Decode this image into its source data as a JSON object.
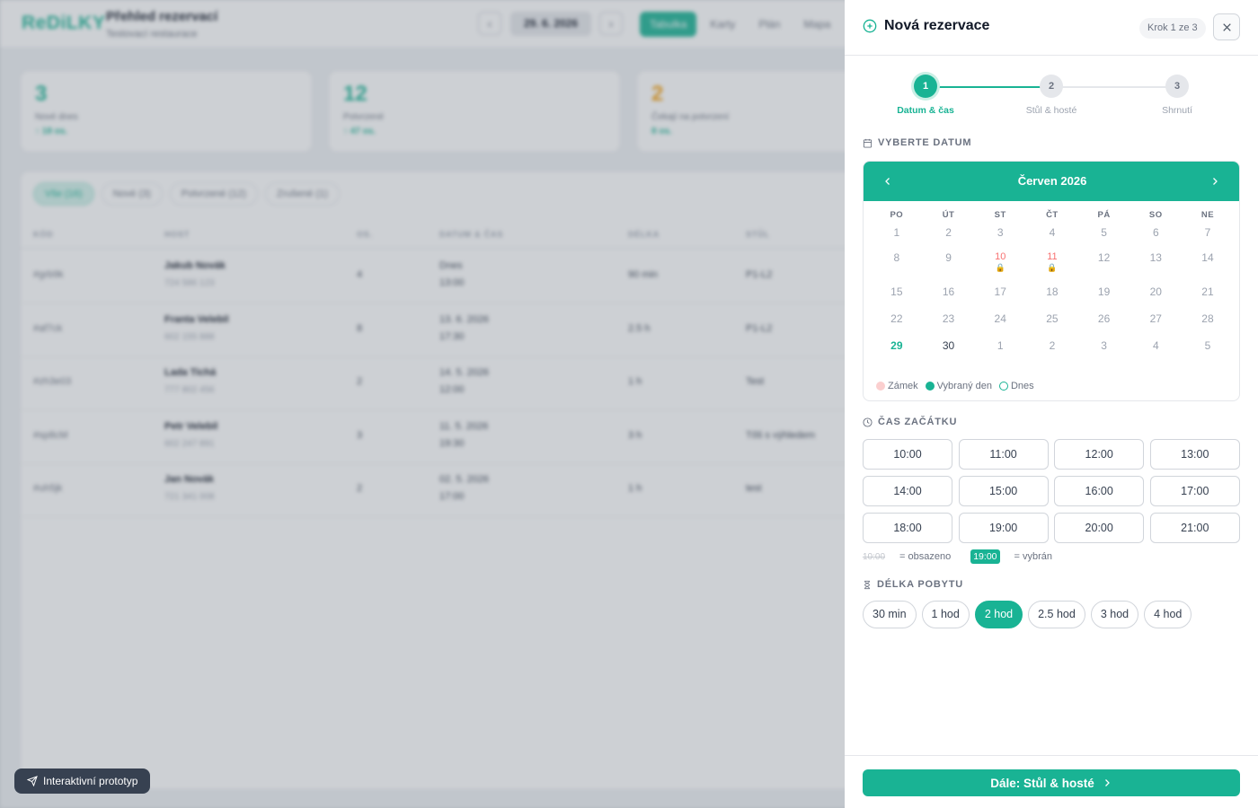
{
  "background": {
    "logo": "ReDiLKY",
    "title": "Přehled rezervací",
    "subtitle": "Testovací restaurace",
    "date": "29. 6. 2026",
    "view_tabs": [
      "Tabulka",
      "Karty",
      "Plán",
      "Mapa"
    ],
    "stats": [
      {
        "value": "3",
        "label": "Nové dnes",
        "delta": "↑ 18 os.",
        "color": "#19b394"
      },
      {
        "value": "12",
        "label": "Potvrzené",
        "delta": "↑ 47 os.",
        "color": "#19b394"
      },
      {
        "value": "2",
        "label": "Čekají na potvrzení",
        "delta": "8 os.",
        "color": "#f59e0b"
      }
    ],
    "filters": [
      "Vše (16)",
      "Nové (3)",
      "Potvrzené (12)",
      "Zrušené (1)"
    ],
    "columns": [
      "KÓD",
      "HOST",
      "OS.",
      "DATUM & ČAS",
      "DÉLKA",
      "STŮL"
    ],
    "rows": [
      {
        "code": "#grb9k",
        "name": "Jakub Novák",
        "phone": "724 586 123",
        "persons": "4",
        "date": "Dnes",
        "time": "13:00",
        "length": "90 min",
        "table": "P1-L2"
      },
      {
        "code": "#af7ck",
        "name": "Franta Velebil",
        "phone": "602 155 888",
        "persons": "8",
        "date": "13. 6. 2026",
        "time": "17:30",
        "length": "2.5 h",
        "table": "P1-L2"
      },
      {
        "code": "#zh3e03",
        "name": "Lada Tichá",
        "phone": "777 802 456",
        "persons": "2",
        "date": "14. 5. 2026",
        "time": "12:00",
        "length": "1 h",
        "table": "Test"
      },
      {
        "code": "#sp8cM",
        "name": "Petr Velebil",
        "phone": "602 247 891",
        "persons": "3",
        "date": "11. 5. 2026",
        "time": "19:30",
        "length": "3 h",
        "table": "Tőš s výhledem"
      },
      {
        "code": "#uh5jk",
        "name": "Jan Novák",
        "phone": "721 341 008",
        "persons": "2",
        "date": "02. 5. 2026",
        "time": "17:00",
        "length": "1 h",
        "table": "test"
      }
    ],
    "badge": "Interaktivní prototyp"
  },
  "panel": {
    "title": "Nová rezervace",
    "step_badge": "Krok 1 ze 3",
    "steps": [
      {
        "num": "1",
        "label": "Datum & čas"
      },
      {
        "num": "2",
        "label": "Stůl & hosté"
      },
      {
        "num": "3",
        "label": "Shrnutí"
      }
    ],
    "date_section": "VYBERTE DATUM",
    "month": "Červen 2026",
    "weekdays": [
      "PO",
      "ÚT",
      "ST",
      "ČT",
      "PÁ",
      "SO",
      "NE"
    ],
    "weeks": [
      [
        {
          "d": "1"
        },
        {
          "d": "2"
        },
        {
          "d": "3"
        },
        {
          "d": "4"
        },
        {
          "d": "5"
        },
        {
          "d": "6"
        },
        {
          "d": "7"
        }
      ],
      [
        {
          "d": "8"
        },
        {
          "d": "9"
        },
        {
          "d": "10",
          "lock": true
        },
        {
          "d": "11",
          "lock": true
        },
        {
          "d": "12"
        },
        {
          "d": "13"
        },
        {
          "d": "14"
        }
      ],
      [
        {
          "d": "15"
        },
        {
          "d": "16"
        },
        {
          "d": "17"
        },
        {
          "d": "18"
        },
        {
          "d": "19"
        },
        {
          "d": "20"
        },
        {
          "d": "21"
        }
      ],
      [
        {
          "d": "22"
        },
        {
          "d": "23"
        },
        {
          "d": "24"
        },
        {
          "d": "25"
        },
        {
          "d": "26"
        },
        {
          "d": "27"
        },
        {
          "d": "28"
        }
      ],
      [
        {
          "d": "29",
          "today": true
        },
        {
          "d": "30",
          "cur": true
        },
        {
          "d": "1"
        },
        {
          "d": "2"
        },
        {
          "d": "3"
        },
        {
          "d": "4"
        },
        {
          "d": "5"
        }
      ]
    ],
    "lock_glyph": "🔒",
    "legend": {
      "lock": "Zámek",
      "selected": "Vybraný den",
      "today": "Dnes"
    },
    "time_section": "ČAS ZAČÁTKU",
    "times": [
      "10:00",
      "11:00",
      "12:00",
      "13:00",
      "14:00",
      "15:00",
      "16:00",
      "17:00",
      "18:00",
      "19:00",
      "20:00",
      "21:00"
    ],
    "time_legend": {
      "occupied_sample": "10:00",
      "occupied": "= obsazeno",
      "selected_sample": "19:00",
      "selected": "= vybrán"
    },
    "duration_section": "DÉLKA POBYTU",
    "durations": [
      "30 min",
      "1 hod",
      "2 hod",
      "2.5 hod",
      "3 hod",
      "4 hod"
    ],
    "selected_duration": "2 hod",
    "next_button": "Dále: Stůl & hosté"
  },
  "colors": {
    "accent": "#19b394",
    "lock": "#f87171",
    "warning": "#f59e0b"
  }
}
